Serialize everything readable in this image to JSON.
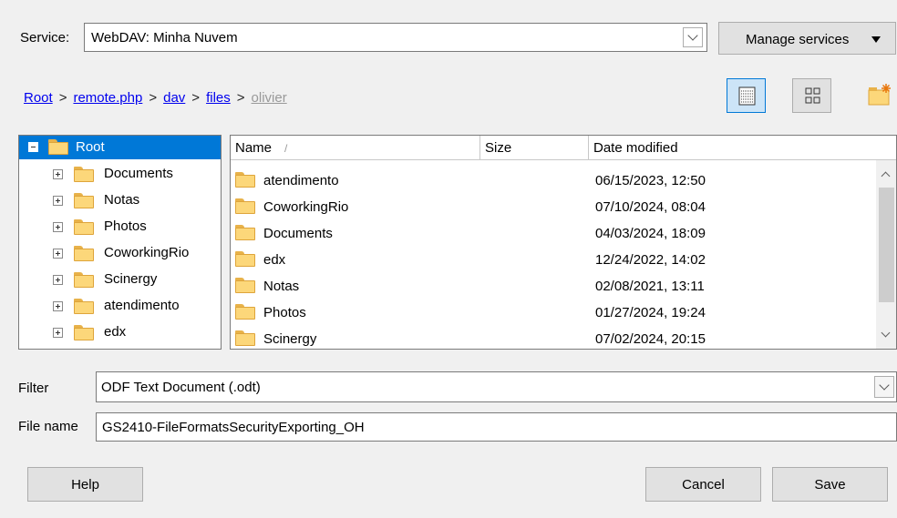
{
  "service": {
    "label": "Service:",
    "value": "WebDAV: Minha Nuvem",
    "manage_label": "Manage services"
  },
  "breadcrumb": {
    "items": [
      "Root",
      "remote.php",
      "dav",
      "files"
    ],
    "current": "olivier",
    "separator": ">"
  },
  "tree": {
    "root": "Root",
    "items": [
      "Documents",
      "Notas",
      "Photos",
      "CoworkingRio",
      "Scinergy",
      "atendimento",
      "edx"
    ]
  },
  "filelist": {
    "columns": {
      "name": "Name",
      "sort_indicator": "/",
      "size": "Size",
      "date": "Date modified"
    },
    "rows": [
      {
        "name": "atendimento",
        "date": "06/15/2023, 12:50"
      },
      {
        "name": "CoworkingRio",
        "date": "07/10/2024, 08:04"
      },
      {
        "name": "Documents",
        "date": "04/03/2024, 18:09"
      },
      {
        "name": "edx",
        "date": "12/24/2022, 14:02"
      },
      {
        "name": "Notas",
        "date": "02/08/2021, 13:11"
      },
      {
        "name": "Photos",
        "date": "01/27/2024, 19:24"
      },
      {
        "name": "Scinergy",
        "date": "07/02/2024, 20:15"
      }
    ]
  },
  "filter": {
    "label": "Filter",
    "value": "ODF Text Document (.odt)"
  },
  "filename": {
    "label": "File name",
    "value": "GS2410-FileFormatsSecurityExporting_OH"
  },
  "buttons": {
    "help": "Help",
    "cancel": "Cancel",
    "save": "Save"
  },
  "colors": {
    "accent": "#0078d7",
    "folder": "#fcd77a"
  }
}
